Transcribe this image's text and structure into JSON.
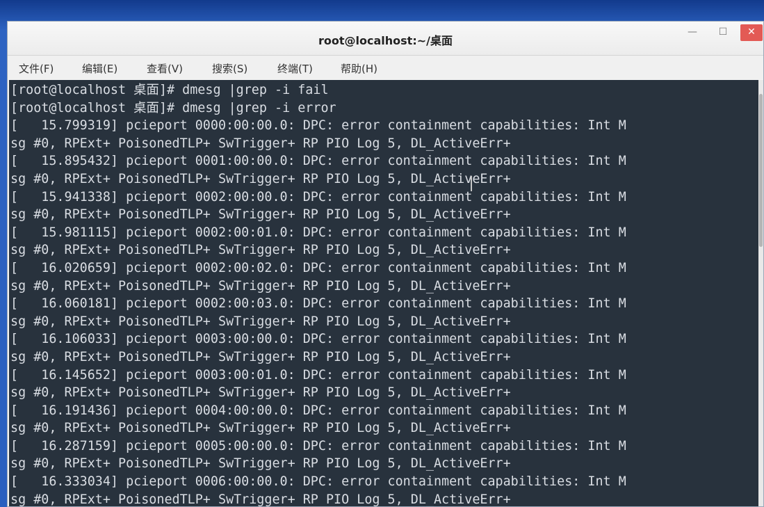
{
  "window": {
    "title": "root@localhost:~/桌面",
    "minimize": "—",
    "maximize": "☐",
    "close": "✕"
  },
  "menu": {
    "file": "文件(F)",
    "edit": "编辑(E)",
    "view": "查看(V)",
    "search": "搜索(S)",
    "terminal": "终端(T)",
    "help": "帮助(H)"
  },
  "terminal": {
    "lines": [
      "[root@localhost 桌面]# dmesg |grep -i fail",
      "[root@localhost 桌面]# dmesg |grep -i error",
      "[   15.799319] pcieport 0000:00:00.0: DPC: error containment capabilities: Int M",
      "sg #0, RPExt+ PoisonedTLP+ SwTrigger+ RP PIO Log 5, DL_ActiveErr+",
      "[   15.895432] pcieport 0001:00:00.0: DPC: error containment capabilities: Int M",
      "sg #0, RPExt+ PoisonedTLP+ SwTrigger+ RP PIO Log 5, DL_ActiveErr+",
      "[   15.941338] pcieport 0002:00:00.0: DPC: error containment capabilities: Int M",
      "sg #0, RPExt+ PoisonedTLP+ SwTrigger+ RP PIO Log 5, DL_ActiveErr+",
      "[   15.981115] pcieport 0002:00:01.0: DPC: error containment capabilities: Int M",
      "sg #0, RPExt+ PoisonedTLP+ SwTrigger+ RP PIO Log 5, DL_ActiveErr+",
      "[   16.020659] pcieport 0002:00:02.0: DPC: error containment capabilities: Int M",
      "sg #0, RPExt+ PoisonedTLP+ SwTrigger+ RP PIO Log 5, DL_ActiveErr+",
      "[   16.060181] pcieport 0002:00:03.0: DPC: error containment capabilities: Int M",
      "sg #0, RPExt+ PoisonedTLP+ SwTrigger+ RP PIO Log 5, DL_ActiveErr+",
      "[   16.106033] pcieport 0003:00:00.0: DPC: error containment capabilities: Int M",
      "sg #0, RPExt+ PoisonedTLP+ SwTrigger+ RP PIO Log 5, DL_ActiveErr+",
      "[   16.145652] pcieport 0003:00:01.0: DPC: error containment capabilities: Int M",
      "sg #0, RPExt+ PoisonedTLP+ SwTrigger+ RP PIO Log 5, DL_ActiveErr+",
      "[   16.191436] pcieport 0004:00:00.0: DPC: error containment capabilities: Int M",
      "sg #0, RPExt+ PoisonedTLP+ SwTrigger+ RP PIO Log 5, DL_ActiveErr+",
      "[   16.287159] pcieport 0005:00:00.0: DPC: error containment capabilities: Int M",
      "sg #0, RPExt+ PoisonedTLP+ SwTrigger+ RP PIO Log 5, DL_ActiveErr+",
      "[   16.333034] pcieport 0006:00:00.0: DPC: error containment capabilities: Int M",
      "sg #0, RPExt+ PoisonedTLP+ SwTrigger+ RP PIO Log 5, DL_ActiveErr+"
    ]
  },
  "colors": {
    "terminal_bg": "#28323d",
    "terminal_fg": "#d9dde3",
    "close_button": "#e35a55",
    "desktop": "#2a5fbf"
  }
}
